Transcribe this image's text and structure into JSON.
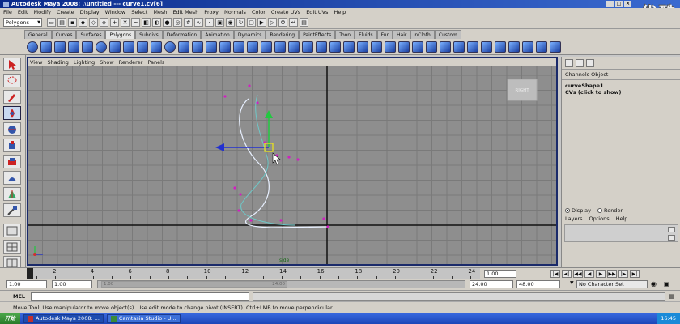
{
  "window": {
    "title": "Autodesk Maya 2008: .\\untitled   ---   curve1.cv[6]",
    "watermark": "优酷"
  },
  "menubar": [
    "File",
    "Edit",
    "Modify",
    "Create",
    "Display",
    "Window",
    "Select",
    "Mesh",
    "Edit Mesh",
    "Proxy",
    "Normals",
    "Color",
    "Create UVs",
    "Edit UVs",
    "Help"
  ],
  "status_line": {
    "mode": "Polygons"
  },
  "shelf_tabs": [
    "General",
    "Curves",
    "Surfaces",
    "Polygons",
    "Subdivs",
    "Deformation",
    "Animation",
    "Dynamics",
    "Rendering",
    "PaintEffects",
    "Toon",
    "Fluids",
    "Fur",
    "Hair",
    "nCloth",
    "Custom"
  ],
  "shelf_active": "Polygons",
  "panel_menu": [
    "View",
    "Shading",
    "Lighting",
    "Show",
    "Renderer",
    "Panels"
  ],
  "viewport": {
    "camera_name": "side",
    "view_cube_label": "RIGHT"
  },
  "channel_box": {
    "menu": [
      "Channels",
      "Object"
    ],
    "node": "curveShape1",
    "cvs_label": "CVs (click to show)"
  },
  "layer_editor": {
    "display_label": "Display",
    "render_label": "Render",
    "menu": [
      "Layers",
      "Options",
      "Help"
    ]
  },
  "timeline": {
    "ticks": [
      "2",
      "4",
      "6",
      "8",
      "10",
      "12",
      "14",
      "16",
      "18",
      "20",
      "22",
      "24"
    ],
    "current_frame": "1.00"
  },
  "range_slider": {
    "start": "1.00",
    "playback_start": "1.00",
    "range_start_label": "1.00",
    "range_end_label": "24.00",
    "playback_end": "24.00",
    "end": "48.00",
    "character_set": "No Character Set"
  },
  "mel": {
    "label": "MEL"
  },
  "help_line": "Move Tool: Use manipulator to move object(s). Use edit mode to change pivot (INSERT).  Ctrl+LMB to move perpendicular.",
  "taskbar": {
    "start_label": "开始",
    "tasks": [
      "Autodesk Maya 2008: ...",
      "Camtasia Studio - U..."
    ],
    "clock": "16:45"
  }
}
